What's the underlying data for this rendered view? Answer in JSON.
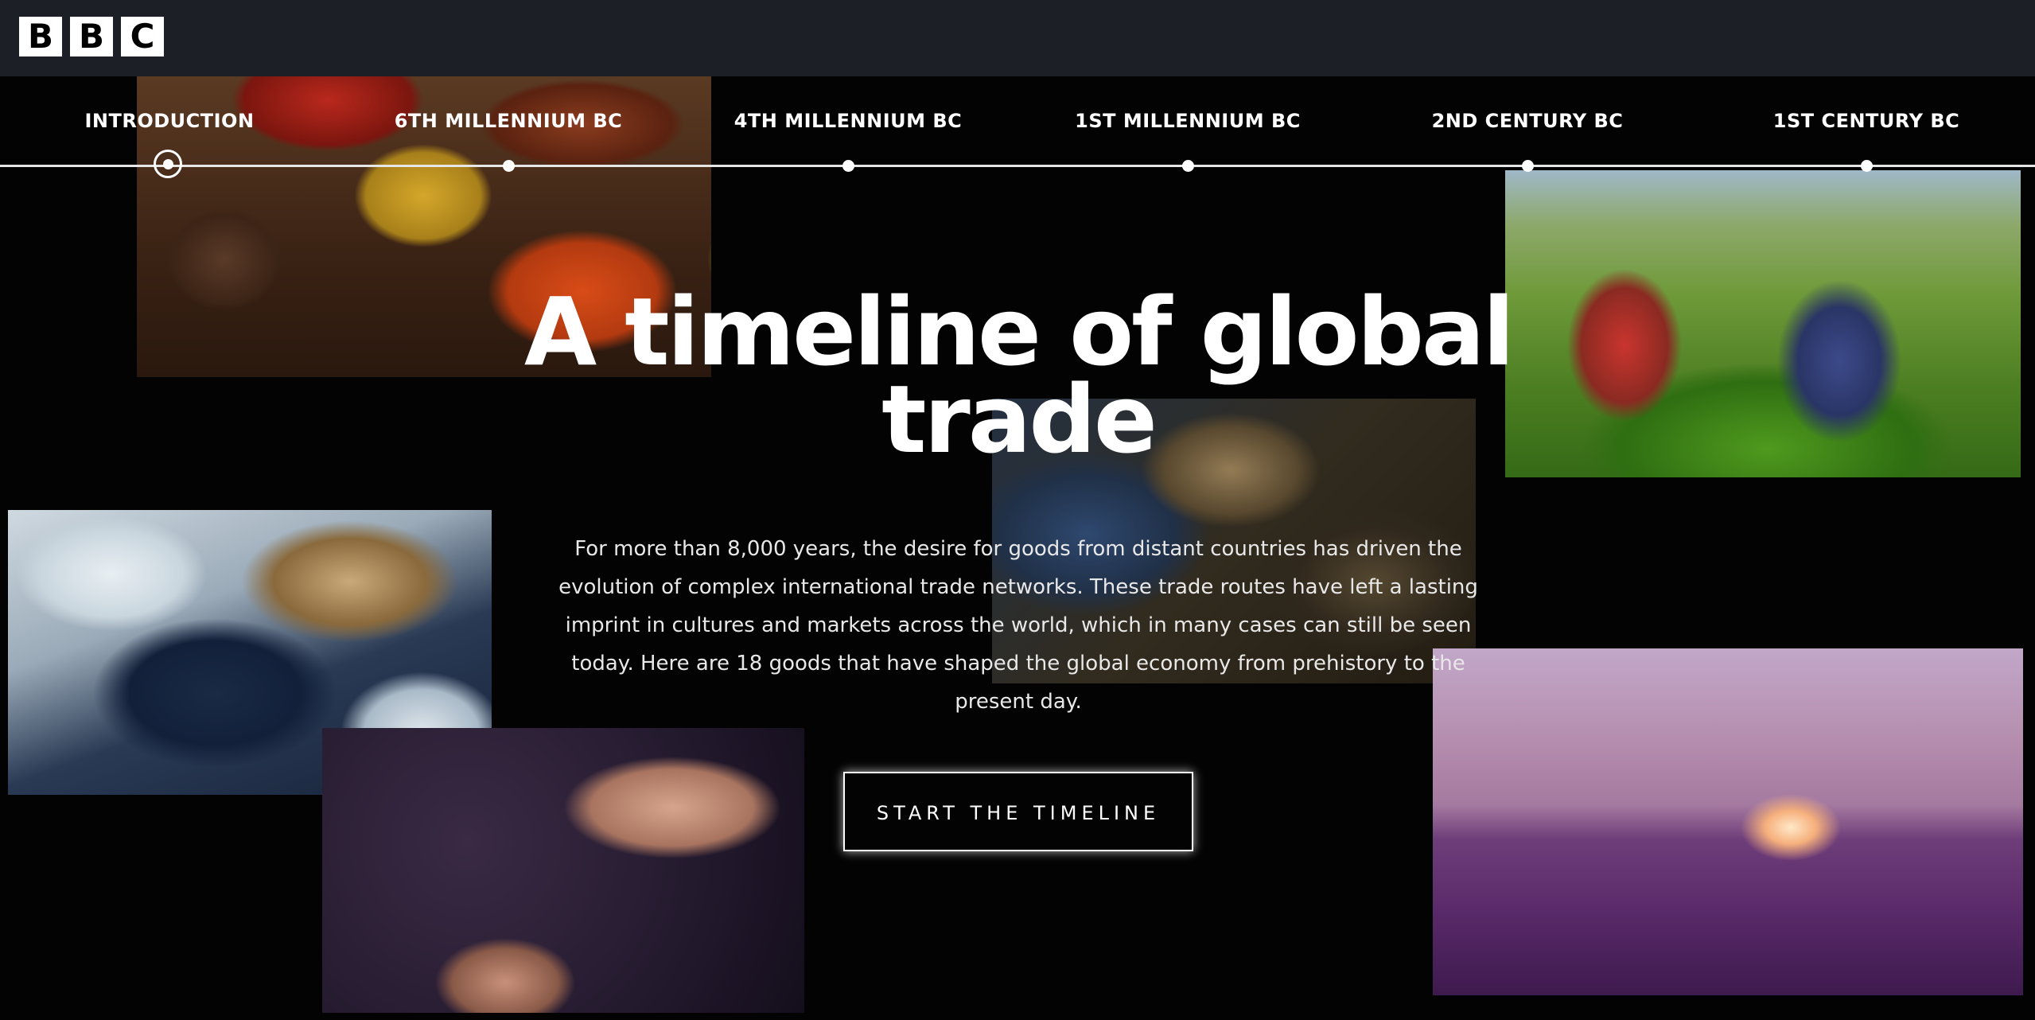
{
  "header": {
    "logo_letters": [
      "B",
      "B",
      "C"
    ]
  },
  "timeline": {
    "items": [
      {
        "label": "INTRODUCTION"
      },
      {
        "label": "6TH MILLENNIUM BC"
      },
      {
        "label": "4TH MILLENNIUM BC"
      },
      {
        "label": "1ST MILLENNIUM BC"
      },
      {
        "label": "2ND CENTURY BC"
      },
      {
        "label": "1ST CENTURY BC"
      }
    ],
    "active_index": 0
  },
  "hero": {
    "title": "A timeline of global trade",
    "intro": "For more than 8,000 years, the desire for goods from distant countries has driven the evolution of complex international trade networks. These trade routes have left a lasting imprint in cultures and markets across the world, which in many cases can still be seen today. Here are 18 goods that have shaped the global economy from prehistory to the present day.",
    "cta_label": "START THE TIMELINE"
  },
  "colors": {
    "header_bg": "#1d1f27",
    "page_bg": "#030303",
    "text": "#ffffff"
  }
}
